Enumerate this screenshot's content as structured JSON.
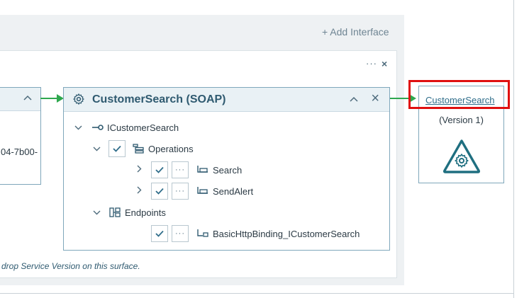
{
  "toolbar": {
    "add_interface_label": "+ Add Interface",
    "more_label": "···",
    "close_label": "×"
  },
  "left_card": {
    "text": "04-7b00-",
    "chevron": "^"
  },
  "service": {
    "title": "CustomerSearch (SOAP)",
    "collapse_glyph": "^",
    "close_glyph": "×",
    "interface_name": "ICustomerSearch",
    "operations_label": "Operations",
    "operations": [
      {
        "label": "Search"
      },
      {
        "label": "SendAlert"
      }
    ],
    "endpoints_label": "Endpoints",
    "endpoints": [
      {
        "label": "BasicHttpBinding_ICustomerSearch"
      }
    ]
  },
  "hint_text": "drop Service Version on this surface.",
  "version_card": {
    "link": "CustomerSearch",
    "subtitle": "(Version 1)"
  },
  "colors": {
    "accent": "#2f6d8a",
    "arrow": "#2fa84f",
    "highlight": "#e01010"
  },
  "icons": {
    "gear": "gear-icon",
    "check": "check-icon",
    "more": "more-icon",
    "interface": "interface-icon",
    "operations": "operations-icon",
    "operation": "operation-icon",
    "endpoints": "endpoints-icon",
    "endpoint": "endpoint-icon"
  }
}
